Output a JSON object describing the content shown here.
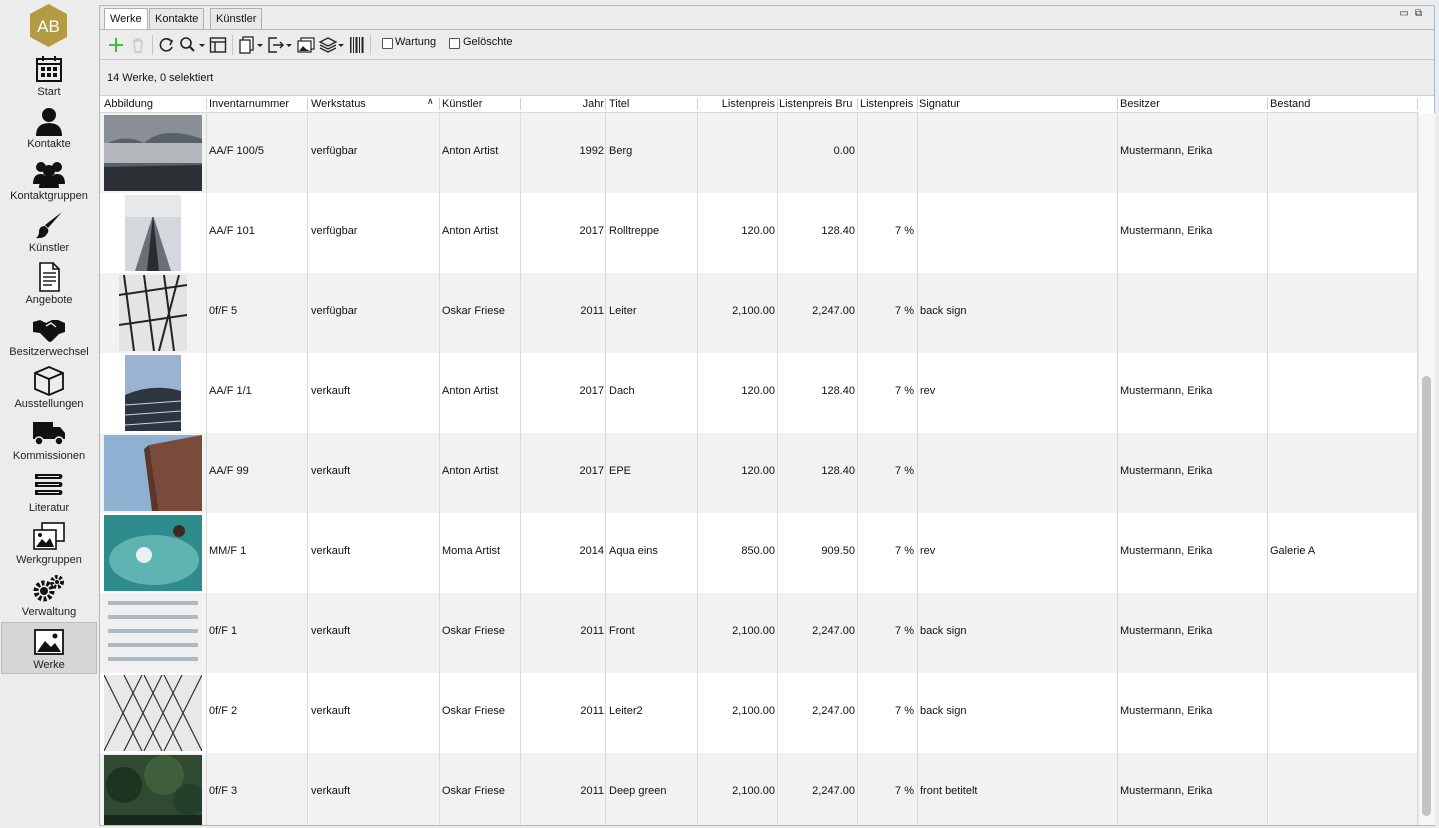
{
  "app": {
    "logo_text": "AB",
    "logo_color": "#b59a45"
  },
  "sidebar": {
    "items": [
      {
        "label": "Start",
        "icon": "calendar-icon"
      },
      {
        "label": "Kontakte",
        "icon": "person-icon"
      },
      {
        "label": "Kontaktgruppen",
        "icon": "group-icon"
      },
      {
        "label": "Künstler",
        "icon": "brush-icon"
      },
      {
        "label": "Angebote",
        "icon": "document-icon"
      },
      {
        "label": "Besitzerwechsel",
        "icon": "handshake-icon"
      },
      {
        "label": "Ausstellungen",
        "icon": "box-icon"
      },
      {
        "label": "Kommissionen",
        "icon": "truck-icon"
      },
      {
        "label": "Literatur",
        "icon": "books-icon"
      },
      {
        "label": "Werkgruppen",
        "icon": "images-icon"
      },
      {
        "label": "Verwaltung",
        "icon": "gears-icon"
      },
      {
        "label": "Werke",
        "icon": "image-icon"
      }
    ],
    "active": "Werke"
  },
  "tabs": [
    {
      "label": "Werke",
      "active": true
    },
    {
      "label": "Kontakte",
      "active": false
    },
    {
      "label": "Künstler",
      "active": false
    }
  ],
  "toolbar": {
    "wartung_label": "Wartung",
    "geloeschte_label": "Gelöschte",
    "add_color": "#3cbf3c"
  },
  "status": {
    "text": "14 Werke, 0 selektiert"
  },
  "table": {
    "columns": [
      "Abbildung",
      "Inventarnummer",
      "Werkstatus",
      "Künstler",
      "Jahr",
      "Titel",
      "Listenpreis",
      "Listenpreis Bru",
      "Listenpreis",
      "Signatur",
      "Besitzer",
      "Bestand"
    ],
    "rows": [
      {
        "inv": "AA/F 100/5",
        "status": "verfügbar",
        "artist": "Anton Artist",
        "year": "1992",
        "title": "Berg",
        "price": "",
        "gross": "0.00",
        "vat": "",
        "sig": "",
        "owner": "Mustermann, Erika",
        "stock": "",
        "img": "landscape-fog"
      },
      {
        "inv": "AA/F 101",
        "status": "verfügbar",
        "artist": "Anton Artist",
        "year": "2017",
        "title": "Rolltreppe",
        "price": "120.00",
        "gross": "128.40",
        "vat": "7 %",
        "sig": "",
        "owner": "Mustermann, Erika",
        "stock": "",
        "img": "escalator"
      },
      {
        "inv": "0f/F 5",
        "status": "verfügbar",
        "artist": "Oskar Friese",
        "year": "2011",
        "title": "Leiter",
        "price": "2,100.00",
        "gross": "2,247.00",
        "vat": "7 %",
        "sig": "back sign",
        "owner": "",
        "stock": "",
        "img": "ladder"
      },
      {
        "inv": "AA/F 1/1",
        "status": "verkauft",
        "artist": "Anton Artist",
        "year": "2017",
        "title": "Dach",
        "price": "120.00",
        "gross": "128.40",
        "vat": "7 %",
        "sig": "rev",
        "owner": "Mustermann, Erika",
        "stock": "",
        "img": "roof"
      },
      {
        "inv": "AA/F 99",
        "status": "verkauft",
        "artist": "Anton Artist",
        "year": "2017",
        "title": "EPE",
        "price": "120.00",
        "gross": "128.40",
        "vat": "7 %",
        "sig": "",
        "owner": "Mustermann, Erika",
        "stock": "",
        "img": "brick-building"
      },
      {
        "inv": "MM/F 1",
        "status": "verkauft",
        "artist": "Moma Artist",
        "year": "2014",
        "title": "Aqua eins",
        "price": "850.00",
        "gross": "909.50",
        "vat": "7 %",
        "sig": "rev",
        "owner": "Mustermann, Erika",
        "stock": "Galerie A",
        "img": "water"
      },
      {
        "inv": "0f/F 1",
        "status": "verkauft",
        "artist": "Oskar Friese",
        "year": "2011",
        "title": "Front",
        "price": "2,100.00",
        "gross": "2,247.00",
        "vat": "7 %",
        "sig": "back sign",
        "owner": "Mustermann, Erika",
        "stock": "",
        "img": "facade"
      },
      {
        "inv": "0f/F 2",
        "status": "verkauft",
        "artist": "Oskar Friese",
        "year": "2011",
        "title": "Leiter2",
        "price": "2,100.00",
        "gross": "2,247.00",
        "vat": "7 %",
        "sig": "back sign",
        "owner": "Mustermann, Erika",
        "stock": "",
        "img": "lattice"
      },
      {
        "inv": "0f/F 3",
        "status": "verkauft",
        "artist": "Oskar Friese",
        "year": "2011",
        "title": "Deep green",
        "price": "2,100.00",
        "gross": "2,247.00",
        "vat": "7 %",
        "sig": "front betitelt",
        "owner": "Mustermann, Erika",
        "stock": "",
        "img": "forest"
      }
    ]
  }
}
